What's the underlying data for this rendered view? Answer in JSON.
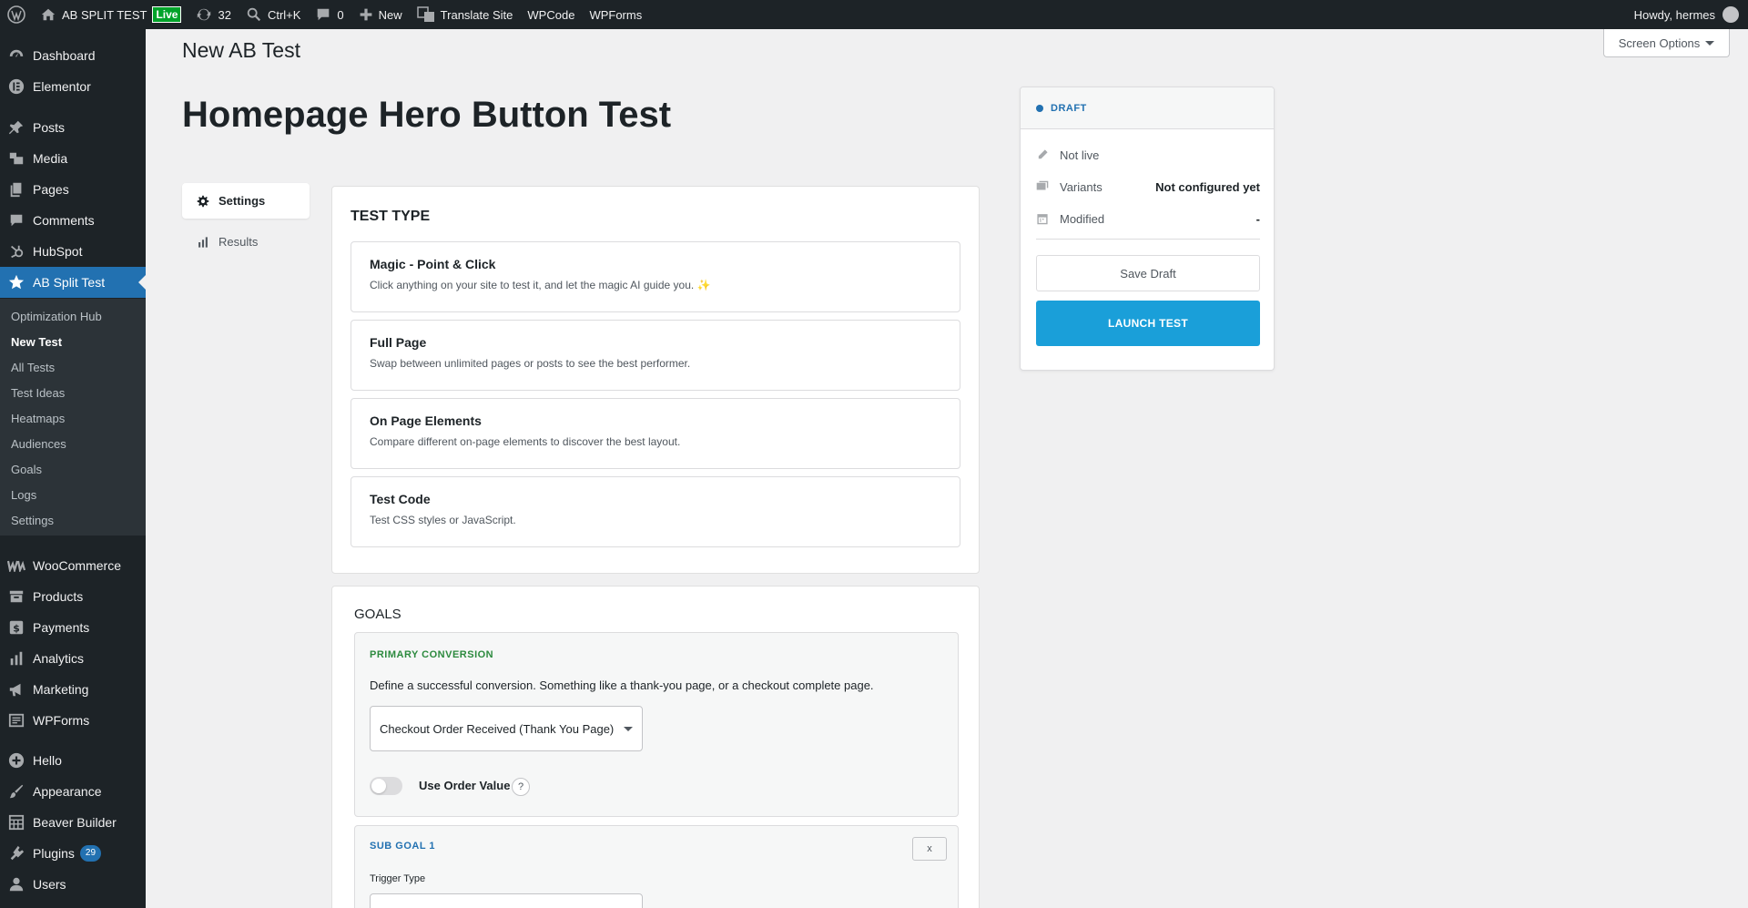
{
  "adminbar": {
    "site_name": "AB SPLIT TEST",
    "live_badge": "Live",
    "updates_count": "32",
    "search_shortcut": "Ctrl+K",
    "comments_count": "0",
    "new_label": "New",
    "translate_label": "Translate Site",
    "wpcode_label": "WPCode",
    "wpforms_label": "WPForms",
    "howdy": "Howdy, hermes"
  },
  "sidebar": {
    "items": [
      {
        "label": "Dashboard",
        "icon": "dashboard-icon"
      },
      {
        "label": "Elementor",
        "icon": "elementor-icon"
      },
      {
        "label": "Posts",
        "icon": "pin-icon"
      },
      {
        "label": "Media",
        "icon": "media-icon"
      },
      {
        "label": "Pages",
        "icon": "pages-icon"
      },
      {
        "label": "Comments",
        "icon": "comment-icon"
      },
      {
        "label": "HubSpot",
        "icon": "hubspot-icon"
      },
      {
        "label": "AB Split Test",
        "icon": "star-icon"
      },
      {
        "label": "WooCommerce",
        "icon": "woo-icon"
      },
      {
        "label": "Products",
        "icon": "archive-icon"
      },
      {
        "label": "Payments",
        "icon": "dollar-icon"
      },
      {
        "label": "Analytics",
        "icon": "chart-icon"
      },
      {
        "label": "Marketing",
        "icon": "megaphone-icon"
      },
      {
        "label": "WPForms",
        "icon": "form-icon"
      },
      {
        "label": "Hello",
        "icon": "plus-circle-icon"
      },
      {
        "label": "Appearance",
        "icon": "brush-icon"
      },
      {
        "label": "Beaver Builder",
        "icon": "grid-icon"
      },
      {
        "label": "Plugins",
        "icon": "plugin-icon"
      },
      {
        "label": "Users",
        "icon": "user-icon"
      }
    ],
    "plugins_count": "29",
    "submenu": [
      "Optimization Hub",
      "New Test",
      "All Tests",
      "Test Ideas",
      "Heatmaps",
      "Audiences",
      "Goals",
      "Logs",
      "Settings"
    ]
  },
  "header": {
    "screen_options": "Screen Options",
    "page_heading": "New AB Test",
    "test_title": "Homepage Hero Button Test"
  },
  "tabs": {
    "settings": "Settings",
    "results": "Results"
  },
  "test_type": {
    "title": "TEST TYPE",
    "options": [
      {
        "title": "Magic - Point & Click",
        "desc": "Click anything on your site to test it, and let the magic AI guide you. ✨"
      },
      {
        "title": "Full Page",
        "desc": "Swap between unlimited pages or posts to see the best performer."
      },
      {
        "title": "On Page Elements",
        "desc": "Compare different on-page elements to discover the best layout."
      },
      {
        "title": "Test Code",
        "desc": "Test CSS styles or JavaScript."
      }
    ]
  },
  "goals": {
    "title": "GOALS",
    "primary_label": "PRIMARY CONVERSION",
    "primary_desc": "Define a successful conversion. Something like a thank-you page, or a checkout complete page.",
    "primary_select": "Checkout Order Received (Thank You Page)",
    "use_order_value": "Use Order Value",
    "help": "?",
    "sub_goal_label": "SUB GOAL 1",
    "remove": "x",
    "trigger_type": "Trigger Type"
  },
  "publish": {
    "status": "DRAFT",
    "not_live": "Not live",
    "variants_label": "Variants",
    "variants_value": "Not configured yet",
    "modified_label": "Modified",
    "modified_value": "-",
    "save_draft": "Save Draft",
    "launch": "LAUNCH TEST"
  },
  "colors": {
    "admin_dark": "#1d2327",
    "accent_blue": "#2271b1",
    "launch_blue": "#1a9fd9",
    "primary_green": "#2c8a3e"
  }
}
